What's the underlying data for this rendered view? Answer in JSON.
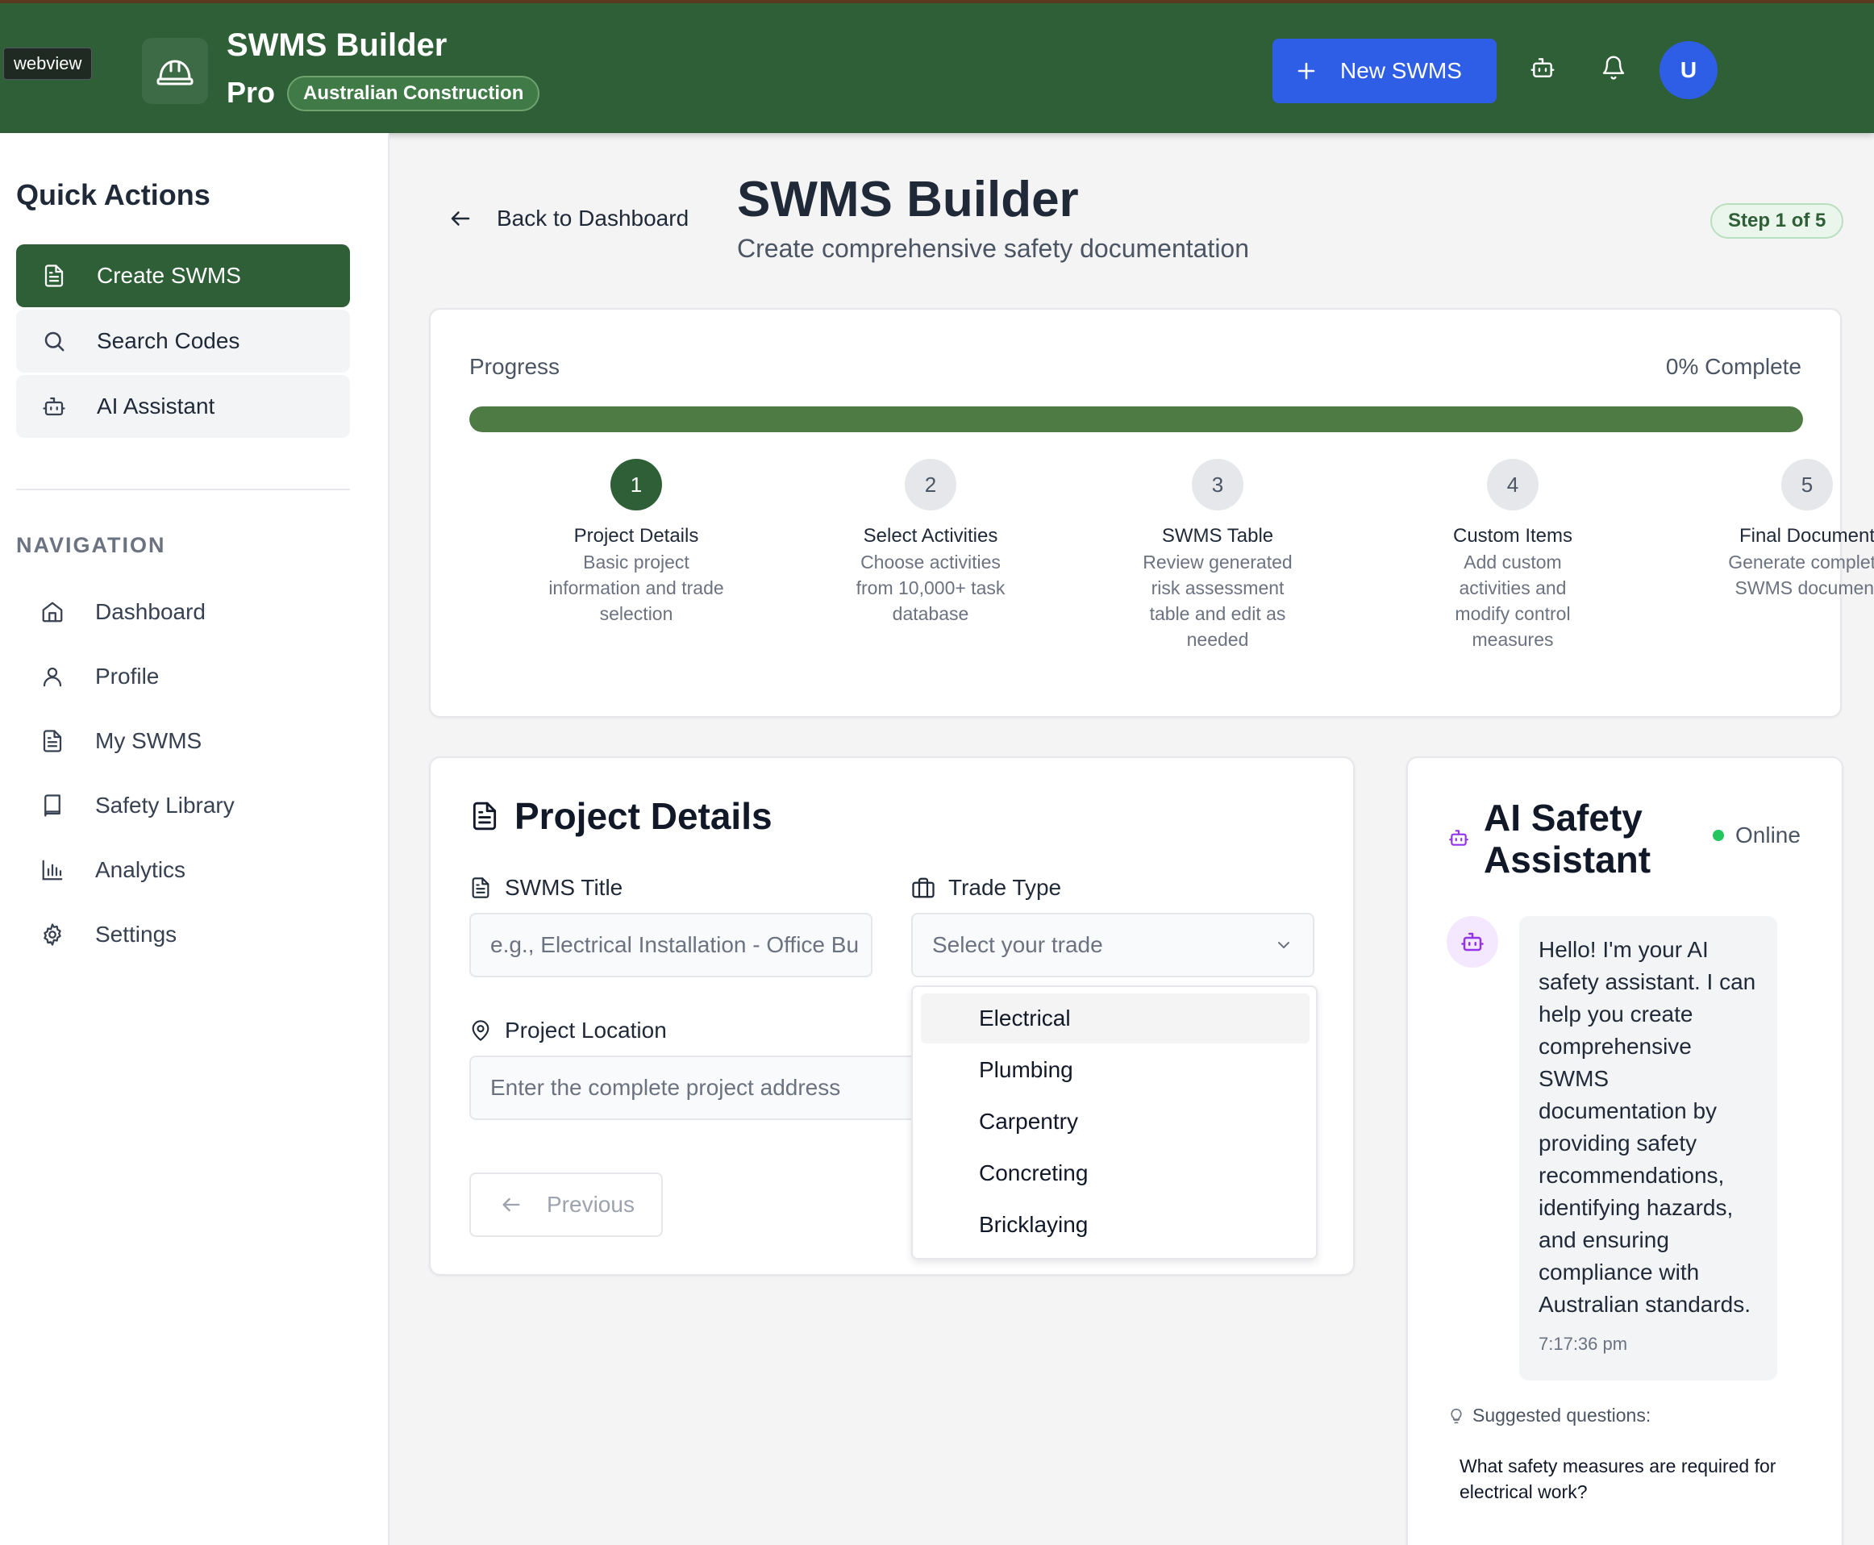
{
  "webview_tag": "webview",
  "header": {
    "title": "SWMS Builder",
    "title_line2": "Pro",
    "region_badge": "Australian Construction",
    "new_button": "New SWMS",
    "avatar_initial": "U"
  },
  "sidebar": {
    "quick_actions_title": "Quick Actions",
    "quick_actions": [
      {
        "label": "Create SWMS",
        "icon": "document-icon",
        "active": true
      },
      {
        "label": "Search Codes",
        "icon": "search-icon"
      },
      {
        "label": "AI Assistant",
        "icon": "bot-icon"
      }
    ],
    "navigation_title": "NAVIGATION",
    "nav": [
      {
        "label": "Dashboard",
        "icon": "home-icon"
      },
      {
        "label": "Profile",
        "icon": "user-icon"
      },
      {
        "label": "My SWMS",
        "icon": "document-icon"
      },
      {
        "label": "Safety Library",
        "icon": "book-icon"
      },
      {
        "label": "Analytics",
        "icon": "bar-chart-icon"
      },
      {
        "label": "Settings",
        "icon": "gear-icon"
      }
    ]
  },
  "page": {
    "back_label": "Back to Dashboard",
    "title": "SWMS Builder",
    "subtitle": "Create comprehensive safety documentation",
    "step_badge": "Step 1 of 5"
  },
  "progress": {
    "label": "Progress",
    "percent_label": "0% Complete",
    "fill_fraction": 1.0,
    "steps": [
      {
        "number": "1",
        "title": "Project Details",
        "desc": "Basic project information and trade selection",
        "active": true
      },
      {
        "number": "2",
        "title": "Select Activities",
        "desc": "Choose activities from 10,000+ task database"
      },
      {
        "number": "3",
        "title": "SWMS Table",
        "desc": "Review generated risk assessment table and edit as needed"
      },
      {
        "number": "4",
        "title": "Custom Items",
        "desc": "Add custom activities and modify control measures"
      },
      {
        "number": "5",
        "title": "Final Document",
        "desc": "Generate complete SWMS document"
      }
    ]
  },
  "form": {
    "title": "Project Details",
    "swms_title_label": "SWMS Title",
    "swms_title_placeholder": "e.g., Electrical Installation - Office Bu",
    "trade_label": "Trade Type",
    "trade_placeholder": "Select your trade",
    "location_label": "Project Location",
    "location_placeholder": "Enter the complete project address",
    "previous_button": "Previous",
    "trade_options": [
      "Electrical",
      "Plumbing",
      "Carpentry",
      "Concreting",
      "Bricklaying"
    ]
  },
  "ai_panel": {
    "title_line1": "AI Safety",
    "title_line2": "Assistant",
    "status": "Online",
    "message": "Hello! I'm your AI safety assistant. I can help you create comprehensive SWMS documentation by providing safety recommendations, identifying hazards, and ensuring compliance with Australian standards.",
    "timestamp": "7:17:36 pm",
    "suggested_label": "Suggested questions:",
    "suggested_questions": [
      "What safety measures are required for electrical work?"
    ]
  },
  "colors": {
    "header_green": "#2e5f37",
    "accent_blue": "#2f5ee6",
    "progress_green": "#4e7a44",
    "online_green": "#22c55e",
    "bot_purple": "#9333ea"
  }
}
